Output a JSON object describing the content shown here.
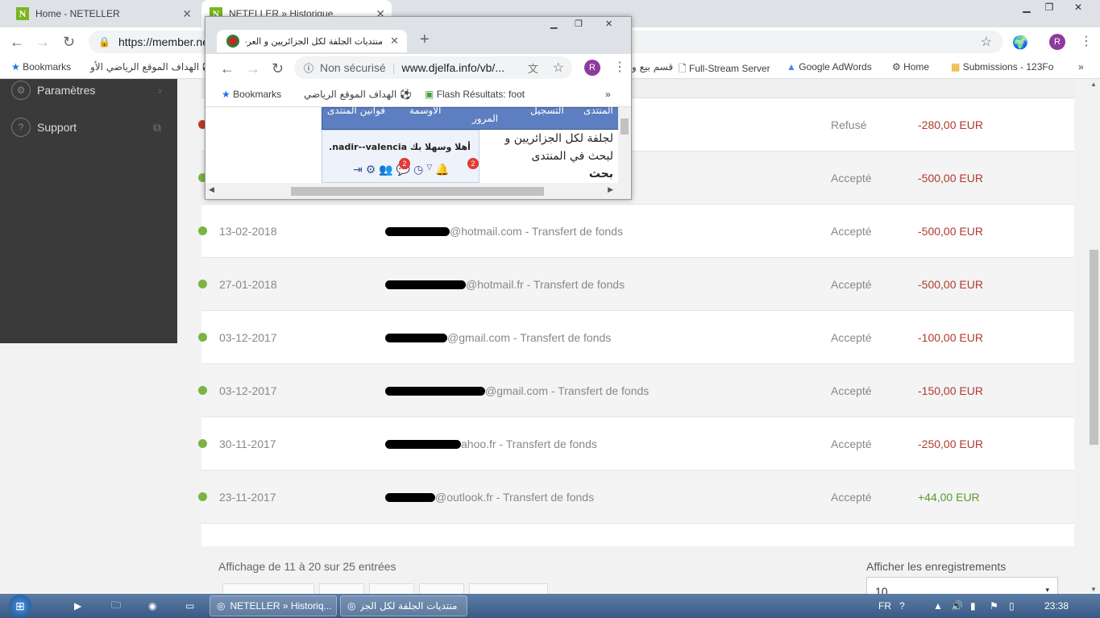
{
  "browser": {
    "tabs": [
      {
        "label": "Home - NETELLER",
        "fav": "N"
      },
      {
        "label": "NETELLER » Historique",
        "fav": "N"
      }
    ],
    "url": "https://member.ne",
    "profile": "R",
    "bookmarks": [
      "Bookmarks",
      "الهداف الموقع الرياضي الأو",
      "قسم بيع و",
      "Full-Stream Server",
      "Google AdWords",
      "Home",
      "Submissions - 123Fo"
    ]
  },
  "sidebar": {
    "items": [
      {
        "label": "Paramètres",
        "icon": "gear-icon"
      },
      {
        "label": "Support",
        "icon": "help-icon"
      }
    ]
  },
  "transactions": [
    {
      "date": "",
      "desc": "",
      "status": "Refusé",
      "amount": "-280,00 EUR",
      "state": "refused"
    },
    {
      "date": "",
      "desc": "",
      "status": "Accepté",
      "amount": "-500,00 EUR",
      "state": "ok"
    },
    {
      "date": "13-02-2018",
      "desc": "@hotmail.com - Transfert de fonds",
      "status": "Accepté",
      "amount": "-500,00 EUR",
      "state": "ok"
    },
    {
      "date": "27-01-2018",
      "desc": "@hotmail.fr - Transfert de fonds",
      "status": "Accepté",
      "amount": "-500,00 EUR",
      "state": "ok"
    },
    {
      "date": "03-12-2017",
      "desc": "@gmail.com - Transfert de fonds",
      "status": "Accepté",
      "amount": "-100,00 EUR",
      "state": "ok"
    },
    {
      "date": "03-12-2017",
      "desc": "@gmail.com - Transfert de fonds",
      "status": "Accepté",
      "amount": "-150,00 EUR",
      "state": "ok"
    },
    {
      "date": "30-11-2017",
      "desc": "ahoo.fr - Transfert de fonds",
      "status": "Accepté",
      "amount": "-250,00 EUR",
      "state": "ok"
    },
    {
      "date": "23-11-2017",
      "desc": "@outlook.fr - Transfert de fonds",
      "status": "Accepté",
      "amount": "+44,00 EUR",
      "state": "ok"
    }
  ],
  "footer": {
    "info": "Affichage de 11 à 20 sur 25 entrées",
    "records_label": "Afficher les enregistrements",
    "records_value": "10"
  },
  "popup": {
    "tab_title": "منتديات الجلفة لكل الجزائريين و العرب - ...",
    "security": "Non sécurisé",
    "url": "www.djelfa.info/vb/...",
    "profile": "R",
    "bookmarks": [
      "Bookmarks",
      "الهداف الموقع الرياضي الأو",
      "Flash Résultats: foot"
    ],
    "nav": [
      "فوانين المنتدى",
      "الأوسمة",
      "المرور",
      "التسجيل",
      "المنتدى"
    ],
    "welcome": "أهلا وسهلا بك nadir--valencia.",
    "forum_text": [
      "لجلفة لكل الجزائريين و",
      "لبحث في المنتدى",
      "بحث"
    ],
    "badges": [
      "2",
      "2"
    ]
  },
  "taskbar": {
    "items": [
      "NETELLER » Historiq...",
      "منتديات الجلفة لكل الجزا..."
    ],
    "lang": "FR",
    "time": "23:38"
  }
}
